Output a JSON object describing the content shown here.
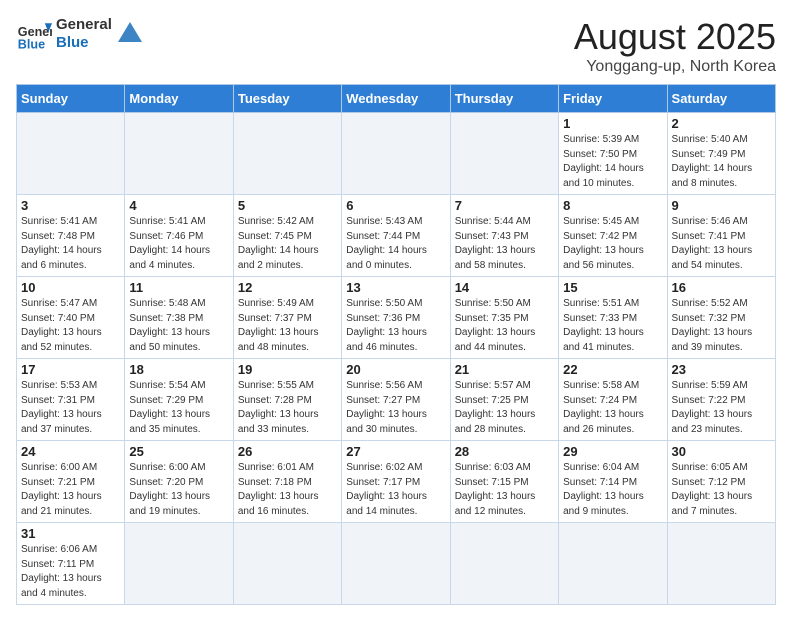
{
  "logo": {
    "text_general": "General",
    "text_blue": "Blue"
  },
  "calendar": {
    "title": "August 2025",
    "subtitle": "Yonggang-up, North Korea",
    "headers": [
      "Sunday",
      "Monday",
      "Tuesday",
      "Wednesday",
      "Thursday",
      "Friday",
      "Saturday"
    ],
    "weeks": [
      [
        {
          "day": "",
          "info": ""
        },
        {
          "day": "",
          "info": ""
        },
        {
          "day": "",
          "info": ""
        },
        {
          "day": "",
          "info": ""
        },
        {
          "day": "",
          "info": ""
        },
        {
          "day": "1",
          "info": "Sunrise: 5:39 AM\nSunset: 7:50 PM\nDaylight: 14 hours and 10 minutes."
        },
        {
          "day": "2",
          "info": "Sunrise: 5:40 AM\nSunset: 7:49 PM\nDaylight: 14 hours and 8 minutes."
        }
      ],
      [
        {
          "day": "3",
          "info": "Sunrise: 5:41 AM\nSunset: 7:48 PM\nDaylight: 14 hours and 6 minutes."
        },
        {
          "day": "4",
          "info": "Sunrise: 5:41 AM\nSunset: 7:46 PM\nDaylight: 14 hours and 4 minutes."
        },
        {
          "day": "5",
          "info": "Sunrise: 5:42 AM\nSunset: 7:45 PM\nDaylight: 14 hours and 2 minutes."
        },
        {
          "day": "6",
          "info": "Sunrise: 5:43 AM\nSunset: 7:44 PM\nDaylight: 14 hours and 0 minutes."
        },
        {
          "day": "7",
          "info": "Sunrise: 5:44 AM\nSunset: 7:43 PM\nDaylight: 13 hours and 58 minutes."
        },
        {
          "day": "8",
          "info": "Sunrise: 5:45 AM\nSunset: 7:42 PM\nDaylight: 13 hours and 56 minutes."
        },
        {
          "day": "9",
          "info": "Sunrise: 5:46 AM\nSunset: 7:41 PM\nDaylight: 13 hours and 54 minutes."
        }
      ],
      [
        {
          "day": "10",
          "info": "Sunrise: 5:47 AM\nSunset: 7:40 PM\nDaylight: 13 hours and 52 minutes."
        },
        {
          "day": "11",
          "info": "Sunrise: 5:48 AM\nSunset: 7:38 PM\nDaylight: 13 hours and 50 minutes."
        },
        {
          "day": "12",
          "info": "Sunrise: 5:49 AM\nSunset: 7:37 PM\nDaylight: 13 hours and 48 minutes."
        },
        {
          "day": "13",
          "info": "Sunrise: 5:50 AM\nSunset: 7:36 PM\nDaylight: 13 hours and 46 minutes."
        },
        {
          "day": "14",
          "info": "Sunrise: 5:50 AM\nSunset: 7:35 PM\nDaylight: 13 hours and 44 minutes."
        },
        {
          "day": "15",
          "info": "Sunrise: 5:51 AM\nSunset: 7:33 PM\nDaylight: 13 hours and 41 minutes."
        },
        {
          "day": "16",
          "info": "Sunrise: 5:52 AM\nSunset: 7:32 PM\nDaylight: 13 hours and 39 minutes."
        }
      ],
      [
        {
          "day": "17",
          "info": "Sunrise: 5:53 AM\nSunset: 7:31 PM\nDaylight: 13 hours and 37 minutes."
        },
        {
          "day": "18",
          "info": "Sunrise: 5:54 AM\nSunset: 7:29 PM\nDaylight: 13 hours and 35 minutes."
        },
        {
          "day": "19",
          "info": "Sunrise: 5:55 AM\nSunset: 7:28 PM\nDaylight: 13 hours and 33 minutes."
        },
        {
          "day": "20",
          "info": "Sunrise: 5:56 AM\nSunset: 7:27 PM\nDaylight: 13 hours and 30 minutes."
        },
        {
          "day": "21",
          "info": "Sunrise: 5:57 AM\nSunset: 7:25 PM\nDaylight: 13 hours and 28 minutes."
        },
        {
          "day": "22",
          "info": "Sunrise: 5:58 AM\nSunset: 7:24 PM\nDaylight: 13 hours and 26 minutes."
        },
        {
          "day": "23",
          "info": "Sunrise: 5:59 AM\nSunset: 7:22 PM\nDaylight: 13 hours and 23 minutes."
        }
      ],
      [
        {
          "day": "24",
          "info": "Sunrise: 6:00 AM\nSunset: 7:21 PM\nDaylight: 13 hours and 21 minutes."
        },
        {
          "day": "25",
          "info": "Sunrise: 6:00 AM\nSunset: 7:20 PM\nDaylight: 13 hours and 19 minutes."
        },
        {
          "day": "26",
          "info": "Sunrise: 6:01 AM\nSunset: 7:18 PM\nDaylight: 13 hours and 16 minutes."
        },
        {
          "day": "27",
          "info": "Sunrise: 6:02 AM\nSunset: 7:17 PM\nDaylight: 13 hours and 14 minutes."
        },
        {
          "day": "28",
          "info": "Sunrise: 6:03 AM\nSunset: 7:15 PM\nDaylight: 13 hours and 12 minutes."
        },
        {
          "day": "29",
          "info": "Sunrise: 6:04 AM\nSunset: 7:14 PM\nDaylight: 13 hours and 9 minutes."
        },
        {
          "day": "30",
          "info": "Sunrise: 6:05 AM\nSunset: 7:12 PM\nDaylight: 13 hours and 7 minutes."
        }
      ],
      [
        {
          "day": "31",
          "info": "Sunrise: 6:06 AM\nSunset: 7:11 PM\nDaylight: 13 hours and 4 minutes."
        },
        {
          "day": "",
          "info": ""
        },
        {
          "day": "",
          "info": ""
        },
        {
          "day": "",
          "info": ""
        },
        {
          "day": "",
          "info": ""
        },
        {
          "day": "",
          "info": ""
        },
        {
          "day": "",
          "info": ""
        }
      ]
    ]
  }
}
